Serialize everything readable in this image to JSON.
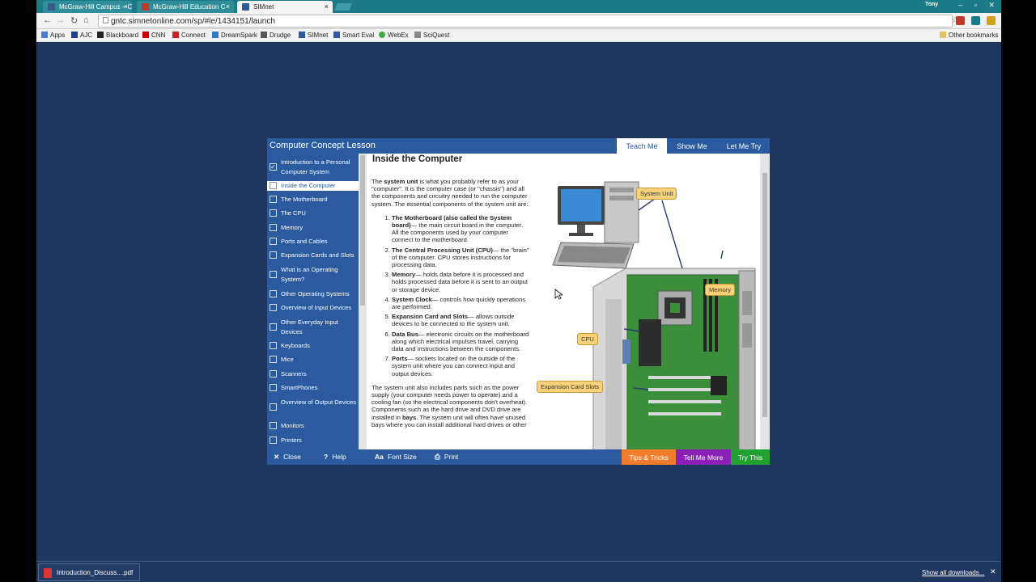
{
  "browser": {
    "tabs": [
      {
        "title": "McGraw-Hill Campus – C",
        "favicon_color": "#3b5a8a"
      },
      {
        "title": "McGraw-Hill Education C",
        "favicon_color": "#c0392b"
      },
      {
        "title": "SIMnet",
        "favicon_color": "#2b5a9e"
      }
    ],
    "user": "Tony",
    "window_controls": [
      "–",
      "▫",
      "✕"
    ],
    "url": "gntc.simnetonline.com/sp/#le/1434151/launch",
    "bookmarks": [
      {
        "label": "Apps",
        "icon_color": "#4a7bd0"
      },
      {
        "label": "AJC",
        "icon_color": "#1e3f8a"
      },
      {
        "label": "Blackboard",
        "icon_color": "#222222"
      },
      {
        "label": "CNN",
        "icon_color": "#cc0000"
      },
      {
        "label": "Connect",
        "icon_color": "#cc2222"
      },
      {
        "label": "DreamSpark",
        "icon_color": "#2c7ac6"
      },
      {
        "label": "Drudge",
        "icon_color": "#555555"
      },
      {
        "label": "SIMnet",
        "icon_color": "#2b5a9e"
      },
      {
        "label": "Smart Eval",
        "icon_color": "#3355aa"
      },
      {
        "label": "WebEx",
        "icon_color": "#44aa44"
      },
      {
        "label": "SciQuest",
        "icon_color": "#888888"
      }
    ],
    "other_bookmarks": "Other bookmarks"
  },
  "lesson": {
    "title": "Computer Concept Lesson",
    "tabs": [
      "Teach Me",
      "Show Me",
      "Let Me Try"
    ],
    "active_tab": "Teach Me",
    "sidebar": [
      {
        "label": "Introduction to a Personal Computer System",
        "checked": true
      },
      {
        "label": "Inside the Computer",
        "active": true
      },
      {
        "label": "The Motherboard"
      },
      {
        "label": "The CPU"
      },
      {
        "label": "Memory"
      },
      {
        "label": "Ports and Cables"
      },
      {
        "label": "Expansion Cards and Slots"
      },
      {
        "label": "What is an Operating System?"
      },
      {
        "label": "Other Operating Systems"
      },
      {
        "label": "Overview of Input Devices"
      },
      {
        "label": "Other Everyday Input Devices"
      },
      {
        "label": "Keyboards"
      },
      {
        "label": "Mice"
      },
      {
        "label": "Scanners"
      },
      {
        "label": "SmartPhones"
      },
      {
        "label": "Overview of Output Devices"
      },
      {
        "label": "Monitors"
      },
      {
        "label": "Printers"
      }
    ],
    "content": {
      "heading": "Inside the Computer",
      "intro_pre": "The ",
      "intro_bold": "system unit",
      "intro_post": " is what you probably refer to as your \"computer\". It is the computer case (or \"chassis\") and all the components and circuitry needed to run the computer system. The essential components of the system unit are:",
      "items": [
        {
          "bold": "The Motherboard (also called the System board)",
          "text": "— the main circuit board in the computer. All the components used by your computer connect to the motherboard."
        },
        {
          "bold": "The Central Processing Unit (CPU)",
          "text": "— the \"brain\" of the computer. CPU stores instructions for processing data."
        },
        {
          "bold": "Memory",
          "text": "— holds data before it is processed and holds processed data before it is sent to an output or storage device."
        },
        {
          "bold": "System Clock",
          "text": "— controls how quickly operations are performed."
        },
        {
          "bold": "Expansion Card and Slots",
          "text": "— allows outside devices to be connected to the system unit."
        },
        {
          "bold": "Data Bus",
          "text": "— electronic circuits on the motherboard along which electrical impulses travel, carrying data and instructions between the components."
        },
        {
          "bold": "Ports",
          "text": "— sockets located on the outside of the system unit where you can connect input and output devices."
        }
      ],
      "outro_pre": "The system unit also includes parts such as the power supply (your computer needs power to operate) and a cooling fan (so the electrical components don't overheat). Components such as the hard drive and DVD drive are installed in ",
      "outro_bold": "bays",
      "outro_post": ". The system unit will often have unused bays where you can install additional hard drives or other"
    },
    "diagram_labels": {
      "system_unit": "System Unit",
      "memory": "Memory",
      "cpu": "CPU",
      "expansion": "Expansion Card Slots"
    },
    "footer": {
      "close": "Close",
      "help": "Help",
      "font_size": "Font Size",
      "print": "Print",
      "tips": "Tips & Tricks",
      "tell_me_more": "Tell Me More",
      "try_this": "Try This"
    },
    "colors": {
      "primary": "#2b5a9e",
      "tips": "#f07c2c",
      "tell_me_more": "#8b1fb8",
      "try_this": "#22a031"
    }
  },
  "downloads": {
    "file": "Introduction_Discuss....pdf",
    "show_all": "Show all downloads..."
  }
}
